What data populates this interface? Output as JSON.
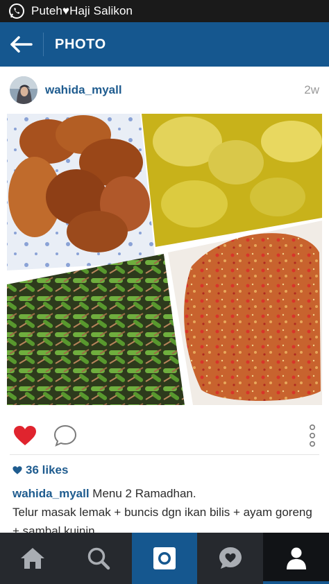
{
  "status_bar": {
    "app_icon": "whatsapp-icon",
    "notification_text": "Puteh♥Haji Salikon"
  },
  "header": {
    "back_icon": "arrow-left-icon",
    "title": "PHOTO"
  },
  "post": {
    "username": "wahida_myall",
    "time_ago": "2w",
    "photo_alt": "Collage of four dishes: fried chicken wings, yellow curry, green beans with anchovies, sambal",
    "likes_text": "36 likes",
    "caption_user": "wahida_myall",
    "caption_text": " Menu 2 Ramadhan.",
    "caption_line2": "Telur masak lemak + buncis dgn ikan bilis + ayam goreng + sambal kuinin"
  },
  "actions": {
    "like_icon": "heart-icon",
    "comment_icon": "comment-icon",
    "more_icon": "more-vertical-icon"
  },
  "bottom_nav": [
    {
      "name": "home",
      "icon": "home-icon"
    },
    {
      "name": "explore",
      "icon": "search-icon"
    },
    {
      "name": "camera",
      "icon": "camera-icon"
    },
    {
      "name": "activity",
      "icon": "heart-bubble-icon"
    },
    {
      "name": "profile",
      "icon": "person-icon"
    }
  ],
  "colors": {
    "brand_blue": "#15578f",
    "link_blue": "#1f5c8f",
    "like_red": "#e0242e",
    "nav_dark": "#26292e"
  }
}
